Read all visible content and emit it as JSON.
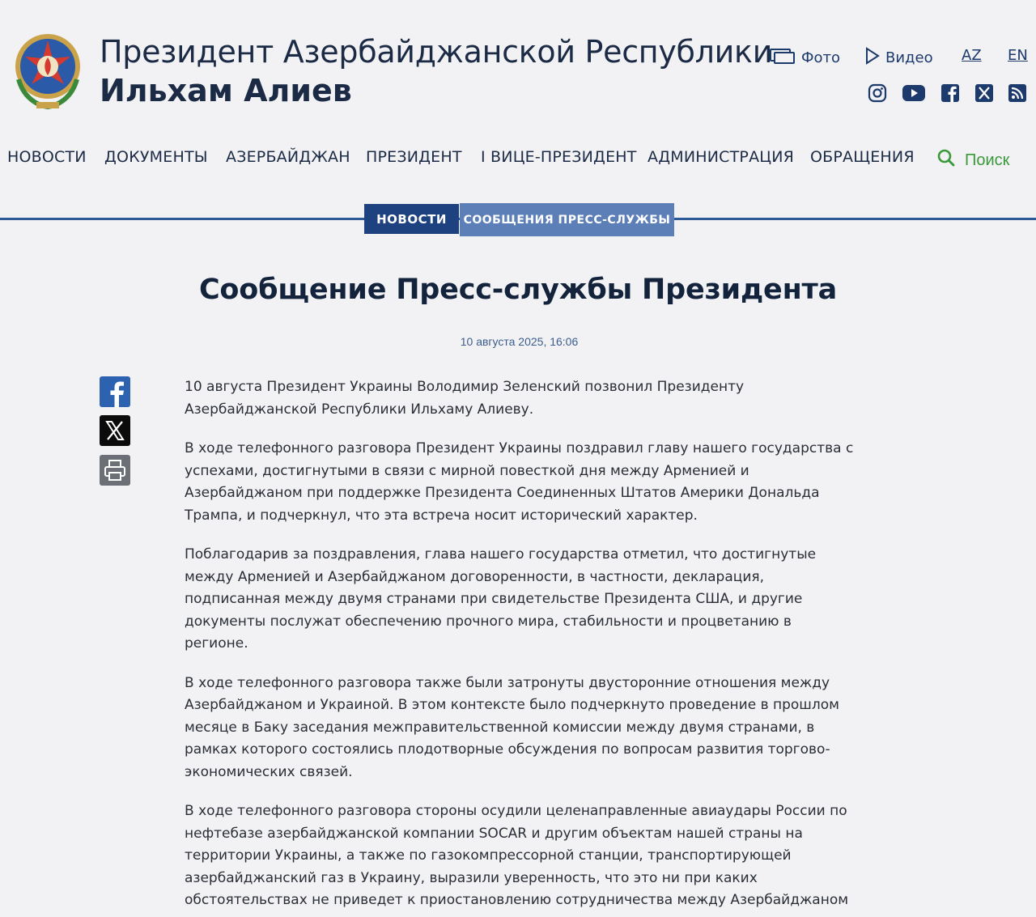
{
  "header": {
    "title_line1": "Президент Азербайджанской Республики",
    "title_line2": "Ильхам Алиев",
    "links": {
      "photo": "Фото",
      "video": "Видео",
      "lang_az": "AZ",
      "lang_en": "EN"
    },
    "social_icons": [
      "instagram-icon",
      "youtube-icon",
      "facebook-icon",
      "x-icon",
      "rss-icon"
    ]
  },
  "nav": {
    "items": [
      "НОВОСТИ",
      "ДОКУМЕНТЫ",
      "АЗЕРБАЙДЖАН",
      "ПРЕЗИДЕНТ",
      "I ВИЦЕ-ПРЕЗИДЕНТ",
      "АДМИНИСТРАЦИЯ",
      "ОБРАЩЕНИЯ"
    ],
    "search_label": "Поиск"
  },
  "section_tabs": {
    "news": "НОВОСТИ",
    "press": "СООБЩЕНИЯ ПРЕСС-СЛУЖБЫ"
  },
  "article": {
    "title": "Сообщение Пресс-службы Президента",
    "date": "10 августа 2025, 16:06",
    "paragraphs": [
      "10 августа Президент Украины Володимир Зеленский позвонил Президенту Азербайджанской Республики Ильхаму Алиеву.",
      "В ходе телефонного разговора Президент Украины поздравил главу нашего государства с успехами, достигнутыми в связи с мирной повесткой дня между Арменией и Азербайджаном при поддержке Президента Соединенных Штатов Америки Дональда Трампа, и подчеркнул, что эта встреча носит исторический характер.",
      "Поблагодарив за поздравления, глава нашего государства отметил, что достигнутые между Арменией и Азербайджаном договоренности, в частности, декларация, подписанная между двумя странами при свидетельстве Президента США, и другие документы послужат обеспечению прочного мира, стабильности и процветанию в регионе.",
      "В ходе телефонного разговора также были затронуты двусторонние отношения между Азербайджаном и Украиной. В этом контексте было подчеркнуто проведение в прошлом месяце в Баку заседания межправительственной комиссии между двумя странами, в рамках которого состоялись плодотворные обсуждения по вопросам развития торгово-экономических связей.",
      "В ходе телефонного разговора стороны осудили целенаправленные авиаудары России по нефтебазе азербайджанской компании SOCAR и другим объектам нашей страны на территории Украины, а также по газокомпрессорной станции, транспортирующей азербайджанский газ в Украину, выразили уверенность, что это ни при каких обстоятельствах не приведет к приостановлению сотрудничества между Азербайджаном"
    ]
  },
  "share": [
    "facebook-icon",
    "x-icon",
    "print-icon"
  ],
  "colors": {
    "background": "#f2f2f4",
    "title": "#1c2b45",
    "nav_blue": "#1e4180",
    "tab_light": "#5c7fb8",
    "search_green": "#3a9a3a"
  }
}
